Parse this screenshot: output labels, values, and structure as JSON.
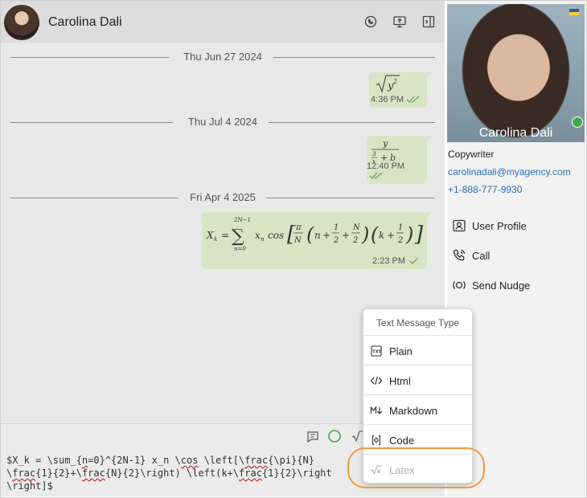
{
  "contact": {
    "name": "Carolina Dali",
    "role": "Copywriter",
    "email": "carolinadali@myagency.com",
    "phone": "+1-888-777-9930"
  },
  "header_icons": [
    "phone-ring-icon",
    "screen-share-icon",
    "sidebar-toggle-icon"
  ],
  "messages": [
    {
      "date": "Thu Jun 27 2024",
      "time": "4:36 PM",
      "status": "read"
    },
    {
      "date": "Thu Jul 4 2024",
      "time": "12:40 PM",
      "status": "read"
    },
    {
      "date": "Fri Apr 4 2025",
      "time": "2:23 PM",
      "status": "sent"
    }
  ],
  "composer": {
    "line1_a": "$X_k = \\sum_{",
    "line1_b": "n",
    "line1_c": "=0}^{2N-1} x_n \\",
    "line1_d": "cos",
    "line1_e": " \\left[\\",
    "line1_f": "frac",
    "line1_g": "{\\pi}{N}",
    "line2_a": "\\",
    "line2_b": "frac",
    "line2_c": "{1}{2}+\\",
    "line2_d": "frac",
    "line2_e": "{N}{2}\\right) \\left(k+\\",
    "line2_f": "frac",
    "line2_g": "{1}{2}\\right",
    "line3": "\\right]$"
  },
  "profile_actions": [
    {
      "label": "User Profile",
      "icon": "user-card-icon"
    },
    {
      "label": "Call",
      "icon": "phone-icon"
    },
    {
      "label": "Send Nudge",
      "icon": "nudge-icon"
    }
  ],
  "menu": {
    "title": "Text Message Type",
    "items": [
      {
        "label": "Plain",
        "icon": "txt-icon",
        "enabled": true
      },
      {
        "label": "Html",
        "icon": "code-brackets-icon",
        "enabled": true
      },
      {
        "label": "Markdown",
        "icon": "markdown-icon",
        "enabled": true
      },
      {
        "label": "Code",
        "icon": "code-gear-icon",
        "enabled": true
      },
      {
        "label": "Latex",
        "icon": "sqrt-icon",
        "enabled": false
      }
    ]
  },
  "colors": {
    "bubble": "#d8e5c4",
    "link": "#2a6fba",
    "online": "#3daa48",
    "highlight": "#f09a3e"
  }
}
